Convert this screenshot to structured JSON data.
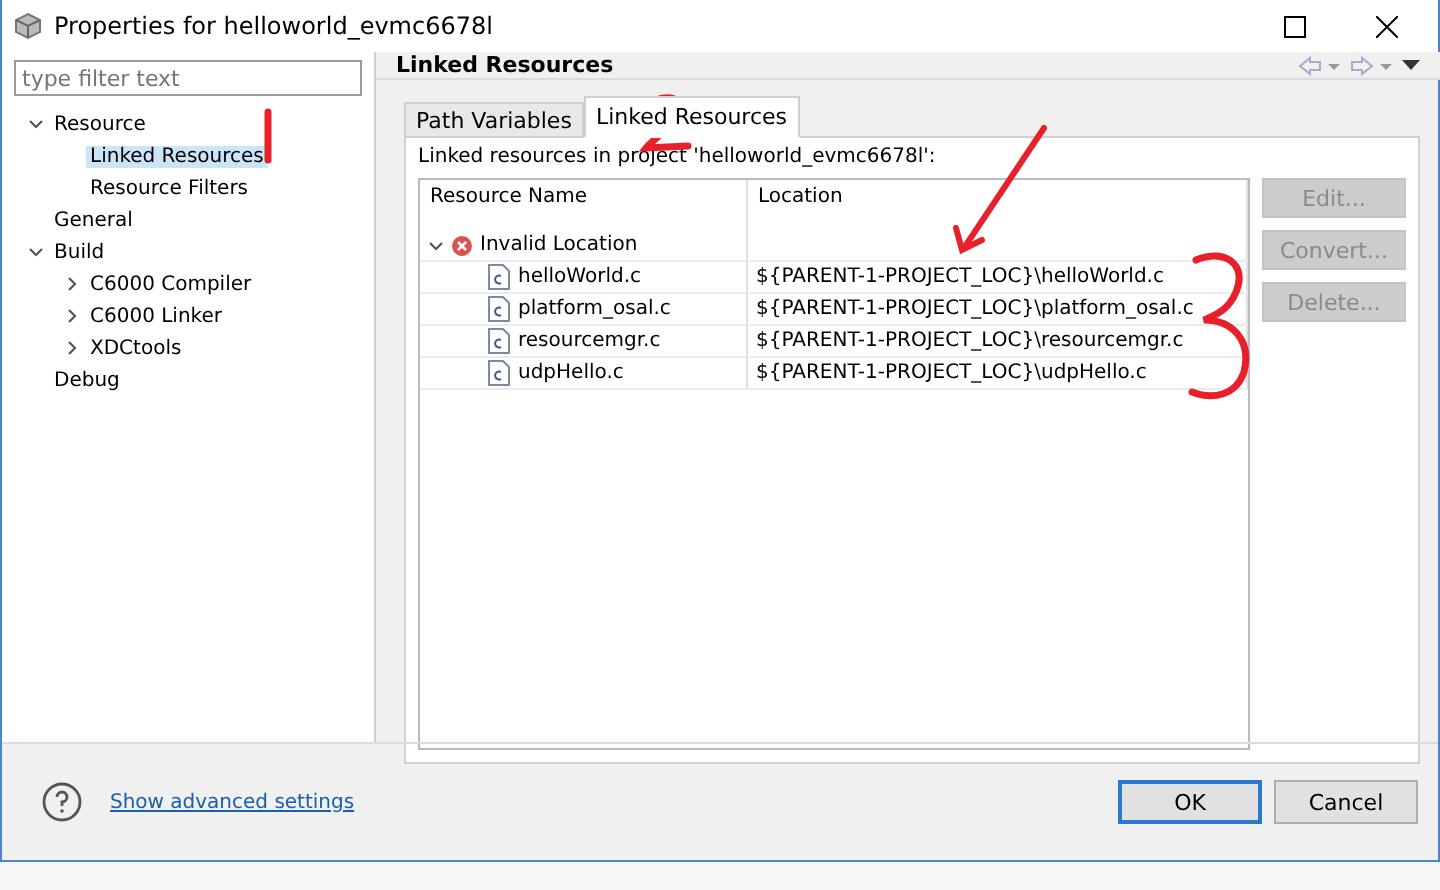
{
  "window": {
    "title": "Properties for helloworld_evmc6678l"
  },
  "filter": {
    "placeholder": "type filter text"
  },
  "nav": [
    {
      "label": "Resource",
      "expanded": true,
      "selected": false,
      "children": [
        {
          "label": "Linked Resources",
          "selected": true
        },
        {
          "label": "Resource Filters",
          "selected": false
        }
      ]
    },
    {
      "label": "General",
      "selected": false
    },
    {
      "label": "Build",
      "expanded": true,
      "selected": false,
      "children": [
        {
          "label": "C6000 Compiler",
          "expanded": false,
          "selected": false
        },
        {
          "label": "C6000 Linker",
          "expanded": false,
          "selected": false
        },
        {
          "label": "XDCtools",
          "expanded": false,
          "selected": false
        }
      ]
    },
    {
      "label": "Debug",
      "selected": false
    }
  ],
  "page_title": "Linked Resources",
  "tabs": [
    {
      "label": "Path Variables",
      "selected": false
    },
    {
      "label": "Linked Resources",
      "selected": true
    }
  ],
  "description": "Linked resources in project 'helloworld_evmc6678l':",
  "table": {
    "columns": [
      "Resource Name",
      "Location"
    ],
    "group": {
      "label": "Invalid Location",
      "expanded": true,
      "rows": [
        {
          "name": "helloWorld.c",
          "location": "${PARENT-1-PROJECT_LOC}\\helloWorld.c"
        },
        {
          "name": "platform_osal.c",
          "location": "${PARENT-1-PROJECT_LOC}\\platform_osal.c"
        },
        {
          "name": "resourcemgr.c",
          "location": "${PARENT-1-PROJECT_LOC}\\resourcemgr.c"
        },
        {
          "name": "udpHello.c",
          "location": "${PARENT-1-PROJECT_LOC}\\udpHello.c"
        }
      ]
    }
  },
  "side_buttons": [
    {
      "label": "Edit...",
      "disabled": true
    },
    {
      "label": "Convert...",
      "disabled": true
    },
    {
      "label": "Delete...",
      "disabled": true
    }
  ],
  "advanced_link": "Show advanced settings",
  "buttons": [
    {
      "label": "OK",
      "default": true
    },
    {
      "label": "Cancel",
      "default": false
    }
  ]
}
